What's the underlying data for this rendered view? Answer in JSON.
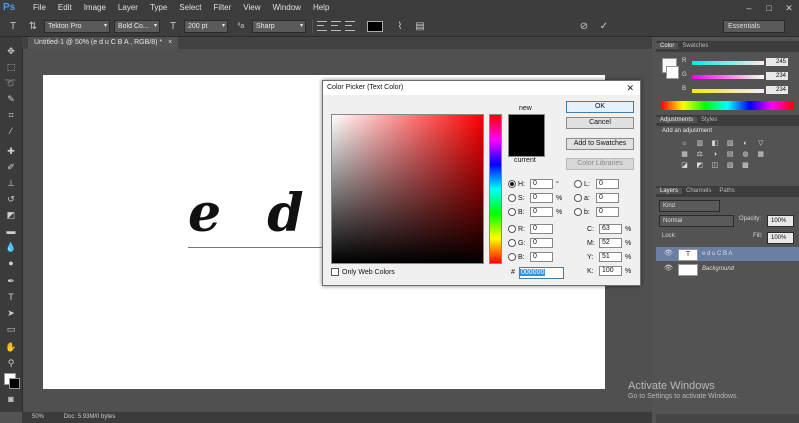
{
  "app": {
    "logo": "Ps"
  },
  "menu": [
    "File",
    "Edit",
    "Image",
    "Layer",
    "Type",
    "Select",
    "Filter",
    "View",
    "Window",
    "Help"
  ],
  "window_controls": {
    "minimize": "–",
    "maximize": "□",
    "close": "✕"
  },
  "options_bar": {
    "font_family": "Tekton Pro",
    "font_style": "Bold Co...",
    "font_size": "200 pt",
    "anti_alias": "Sharp",
    "aa_label": "ªa",
    "workspace": "Essentials",
    "text_color": "#000000"
  },
  "document_tab": {
    "title": "Untitled-1 @ 50% (e d u C B A , RGB/8) *",
    "close": "×"
  },
  "canvas": {
    "text": "e d u C"
  },
  "status": {
    "zoom": "50%",
    "doc": "Doc: 5.93M/0 bytes"
  },
  "color_panel": {
    "tabs": [
      "Color",
      "Swatches"
    ],
    "sliders": [
      {
        "label": "R",
        "value": "245"
      },
      {
        "label": "G",
        "value": "234"
      },
      {
        "label": "B",
        "value": "234"
      }
    ]
  },
  "adjustments_panel": {
    "tabs": [
      "Adjustments",
      "Styles"
    ],
    "title": "Add an adjustment",
    "icons": [
      "☼",
      "▥",
      "◧",
      "▨",
      "◐",
      "▽",
      "▦",
      "⚖",
      "◑",
      "▤",
      "◍",
      "▦",
      "◪",
      "◩",
      "◫",
      "▧",
      "▩",
      "◨"
    ]
  },
  "layers_panel": {
    "tabs": [
      "Layers",
      "Channels",
      "Paths"
    ],
    "kind": "Kind",
    "blend_mode": "Normal",
    "opacity_label": "Opacity:",
    "opacity_value": "100%",
    "lock_label": "Lock:",
    "fill_label": "Fill:",
    "fill_value": "100%",
    "layers": [
      {
        "name": "e d u C B A",
        "thumb": "T",
        "selected": true
      },
      {
        "name": "Background",
        "thumb": "",
        "selected": false
      }
    ]
  },
  "dialog": {
    "title": "Color Picker (Text Color)",
    "close": "✕",
    "new_label": "new",
    "current_label": "current",
    "buttons": {
      "ok": "OK",
      "cancel": "Cancel",
      "add_swatches": "Add to Swatches",
      "color_libraries": "Color Libraries"
    },
    "hsb": [
      {
        "label": "H:",
        "value": "0",
        "unit": "°",
        "selected": true
      },
      {
        "label": "S:",
        "value": "0",
        "unit": "%",
        "selected": false
      },
      {
        "label": "B:",
        "value": "0",
        "unit": "%",
        "selected": false
      }
    ],
    "rgb": [
      {
        "label": "R:",
        "value": "0"
      },
      {
        "label": "G:",
        "value": "0"
      },
      {
        "label": "B:",
        "value": "0"
      }
    ],
    "lab": [
      {
        "label": "L:",
        "value": "0"
      },
      {
        "label": "a:",
        "value": "0"
      },
      {
        "label": "b:",
        "value": "0"
      }
    ],
    "cmyk": [
      {
        "label": "C:",
        "value": "63",
        "unit": "%"
      },
      {
        "label": "M:",
        "value": "52",
        "unit": "%"
      },
      {
        "label": "Y:",
        "value": "51",
        "unit": "%"
      },
      {
        "label": "K:",
        "value": "100",
        "unit": "%"
      }
    ],
    "hex_label": "#",
    "hex_value": "000000",
    "web_colors": "Only Web Colors"
  },
  "watermark": {
    "line1": "Activate Windows",
    "line2": "Go to Settings to activate Windows."
  }
}
